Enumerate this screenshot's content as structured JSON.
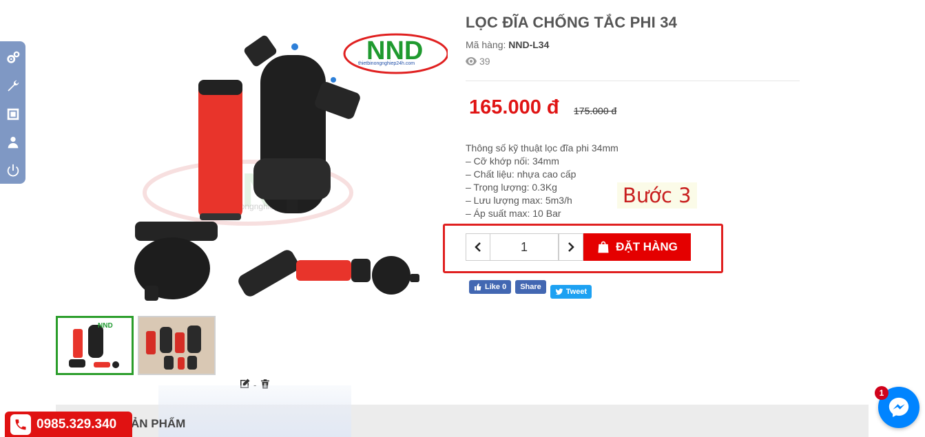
{
  "admin_toolbar": {
    "tools": [
      {
        "icon": "gears-icon"
      },
      {
        "icon": "wrench-icon"
      },
      {
        "icon": "layout-icon"
      },
      {
        "icon": "user-icon"
      },
      {
        "icon": "power-icon"
      }
    ]
  },
  "product": {
    "title": "LỌC ĐĨA CHỐNG TẮC PHI 34",
    "sku_label": "Mã hàng: ",
    "sku": "NND-L34",
    "views": "39",
    "price": "165.000 đ",
    "old_price": "175.000 đ",
    "brand_logo": "NND",
    "brand_site": "thietbinongnghiep24h.com",
    "specs": [
      "Thông số kỹ thuật lọc đĩa phi 34mm",
      "– Cỡ khớp nối: 34mm",
      "– Chất liệu: nhựa cao cấp",
      "– Trọng lượng: 0.3Kg",
      "– Lưu lượng max: 5m3/h",
      "– Áp suất max: 10 Bar"
    ]
  },
  "annotation": {
    "step_label": "Bước 3",
    "highlight_color": "#e02020"
  },
  "order": {
    "quantity": "1",
    "order_button_label": "ĐẶT HÀNG"
  },
  "social": {
    "like_label": "Like 0",
    "share_label": "Share",
    "tweet_label": "Tweet"
  },
  "edit_tools": {
    "separator": "-"
  },
  "bottom": {
    "section_title": "ẢN PHẨM",
    "hotline": "0985.329.340",
    "messenger_badge": "1"
  },
  "colors": {
    "price_red": "#e01414",
    "button_red": "#e40000",
    "thumb_active_border": "#2a9d2a",
    "facebook_blue": "#4267b2",
    "twitter_blue": "#1da1f2",
    "messenger_blue": "#0084ff"
  }
}
